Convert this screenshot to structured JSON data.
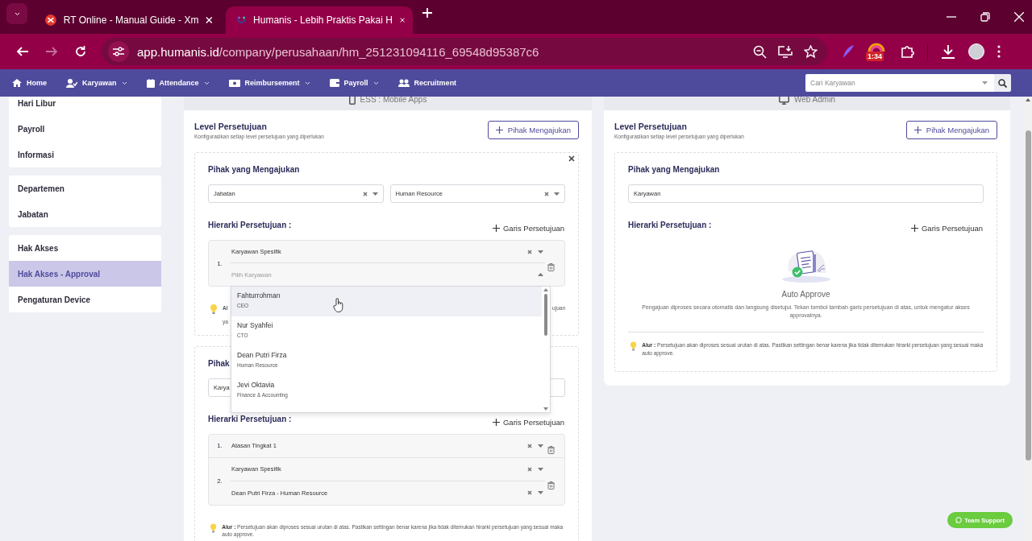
{
  "browser": {
    "tabs": [
      {
        "title": "RT Online - Manual Guide - Xm",
        "selected": false
      },
      {
        "title": "Humanis - Lebih Praktis Pakai H",
        "selected": true
      }
    ],
    "forward_disabled": true,
    "url": {
      "host": "app.humanis.id",
      "path": "/company/perusahaan/hm_251231094116_69548d95387c6"
    },
    "extension_badge": "1:34"
  },
  "nav": {
    "items": [
      {
        "label": "Home",
        "dropdown": false
      },
      {
        "label": "Karyawan",
        "dropdown": true
      },
      {
        "label": "Attendance",
        "dropdown": true
      },
      {
        "label": "Reimbursement",
        "dropdown": true
      },
      {
        "label": "Payroll",
        "dropdown": true
      },
      {
        "label": "Recruitment",
        "dropdown": false
      }
    ],
    "search": {
      "placeholder": "Cari Karyawan"
    }
  },
  "sidebar": {
    "groups": [
      [
        {
          "label": "Hari Libur",
          "selected": false
        },
        {
          "label": "Payroll",
          "selected": false
        },
        {
          "label": "Informasi",
          "selected": false
        }
      ],
      [
        {
          "label": "Departemen",
          "selected": false
        },
        {
          "label": "Jabatan",
          "selected": false
        }
      ],
      [
        {
          "label": "Hak Akses",
          "selected": false
        },
        {
          "label": "Hak Akses - Approval",
          "selected": true
        },
        {
          "label": "Pengaturan Device",
          "selected": false
        }
      ]
    ]
  },
  "panels": [
    {
      "header": {
        "label": "ESS : Mobile Apps"
      },
      "title": "Level Persetujuan",
      "subtitle": "Konfigurasikan setiap level persetujuan yang diperlukan",
      "add_button": "Pihak Mengajukan",
      "groups": [
        {
          "closable": true,
          "heading": "Pihak yang Mengajukan",
          "selects": [
            {
              "value": "Jabatan",
              "clearable": true
            },
            {
              "value": "Human Resource",
              "clearable": true
            }
          ],
          "hierarchy_label": "Hierarki Persetujuan :",
          "add_line": "Garis Persetujuan",
          "levels": [
            {
              "number": "1.",
              "rows": [
                {
                  "value": "Karyawan Spesifik",
                  "clearable": true
                },
                {
                  "placeholder": "Pilih Karyawan",
                  "open": true,
                  "clearable": false
                }
              ]
            }
          ],
          "tip": {
            "kind": "covered",
            "left": [
              "Al",
              "ya"
            ],
            "right": "ujuan"
          }
        },
        {
          "closable": false,
          "heading": "Pihak",
          "selects": [
            {
              "value": "Karya",
              "clearable": false
            }
          ],
          "hierarchy_label": "Hierarki Persetujuan :",
          "add_line": "Garis Persetujuan",
          "levels": [
            {
              "number": "1.",
              "rows": [
                {
                  "value": "Atasan Tingkat 1",
                  "clearable": true
                }
              ]
            },
            {
              "number": "2.",
              "rows": [
                {
                  "value": "Karyawan Spesifik",
                  "clearable": true
                },
                {
                  "value": "Dean Putri Firza - Human Resource",
                  "clearable": true
                }
              ]
            }
          ],
          "tip": {
            "kind": "full",
            "text": "**Alur :** Persetujuan akan diproses sesuai urutan di atas. Pastikan settingan benar karena jika tidak ditemukan hirarki persetujuan yang sesuai maka auto approve."
          }
        }
      ]
    },
    {
      "header": {
        "label": "Web Admin"
      },
      "title": "Level Persetujuan",
      "subtitle": "Konfigurasikan setiap level persetujuan yang diperlukan",
      "add_button": "Pihak Mengajukan",
      "groups": [
        {
          "closable": false,
          "heading": "Pihak yang Mengajukan",
          "selects": [
            {
              "value": "Karyawan",
              "clearable": false
            }
          ],
          "hierarchy_label": "Hierarki Persetujuan :",
          "add_line": "Garis Persetujuan",
          "empty_state": {
            "title": "Auto Approve",
            "text": "Pengajuan diproses secara otomatis dan langsung disetujui. Tekan tombol tambah garis persetujuan di atas, untuk mengatur akses approvalnya."
          },
          "tip": {
            "kind": "full",
            "text": "**Alur :** Persetujuan akan diproses sesuai urutan di atas. Pastikan settingan benar karena jika tidak ditemukan hirarki persetujuan yang sesuai maka auto approve."
          }
        }
      ]
    }
  ],
  "dropdown": {
    "options": [
      {
        "name": "Fahturrohman",
        "role": "CEO",
        "highlighted": true
      },
      {
        "name": "Nur Syahfei",
        "role": "CTO",
        "highlighted": false
      },
      {
        "name": "Dean Putri Firza",
        "role": "Human Resource",
        "highlighted": false
      },
      {
        "name": "Jevi Oktavia",
        "role": "Finance & Accounting",
        "highlighted": false
      }
    ]
  },
  "support_button": "Team Support"
}
